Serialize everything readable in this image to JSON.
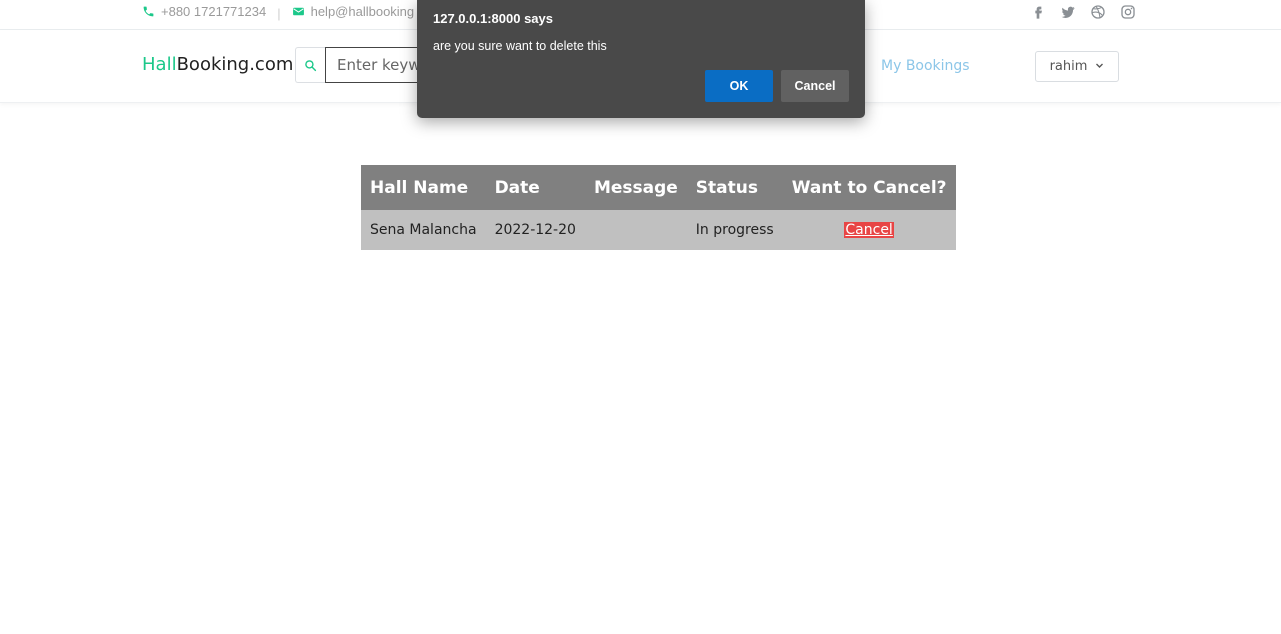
{
  "topbar": {
    "phone": "+880 1721771234",
    "separator": "|",
    "email": "help@hallbooking"
  },
  "social_icons": [
    "facebook-icon",
    "twitter-icon",
    "dribbble-icon",
    "instagram-icon"
  ],
  "navbar": {
    "brand_part1": "Hall",
    "brand_part2": "Booking.com",
    "search_placeholder": "Enter keyw",
    "my_bookings": "My Bookings",
    "user_label": "rahim"
  },
  "table": {
    "headers": [
      "Hall Name",
      "Date",
      "Message",
      "Status",
      "Want to Cancel?"
    ],
    "rows": [
      {
        "hall_name": "Sena Malancha",
        "date": "2022-12-20",
        "message": "",
        "status": "In progress",
        "action": "Cancel"
      }
    ]
  },
  "dialog": {
    "origin": "127.0.0.1:8000 says",
    "message": "are you sure want to delete this",
    "ok_label": "OK",
    "cancel_label": "Cancel"
  },
  "colors": {
    "brand_green": "#1cc88a",
    "link_blue": "#8cc6e8",
    "dialog_bg": "#494949",
    "ok_blue": "#0a6dc4",
    "cancel_red": "#e84545"
  }
}
